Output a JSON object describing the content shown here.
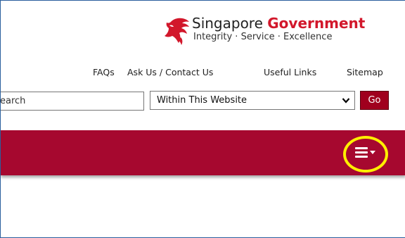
{
  "header": {
    "brand_part1": "Singapore",
    "brand_part2": "Government",
    "tagline": "Integrity · Service · Excellence"
  },
  "util_nav": {
    "faqs": "FAQs",
    "ask_us": "Ask Us / Contact Us",
    "useful_links": "Useful Links",
    "sitemap": "Sitemap"
  },
  "search": {
    "placeholder": "Search",
    "visible_placeholder": "earch",
    "scope_selected": "Within This Website",
    "go_label": "Go"
  },
  "colors": {
    "brand_red": "#d2172b",
    "nav_bar": "#a6082f",
    "go_button": "#a0001e",
    "highlight": "#ffef00"
  },
  "icons": {
    "logo": "singapore-lion-head-icon",
    "menu": "hamburger-menu-icon",
    "dropdown": "chevron-down-icon"
  }
}
